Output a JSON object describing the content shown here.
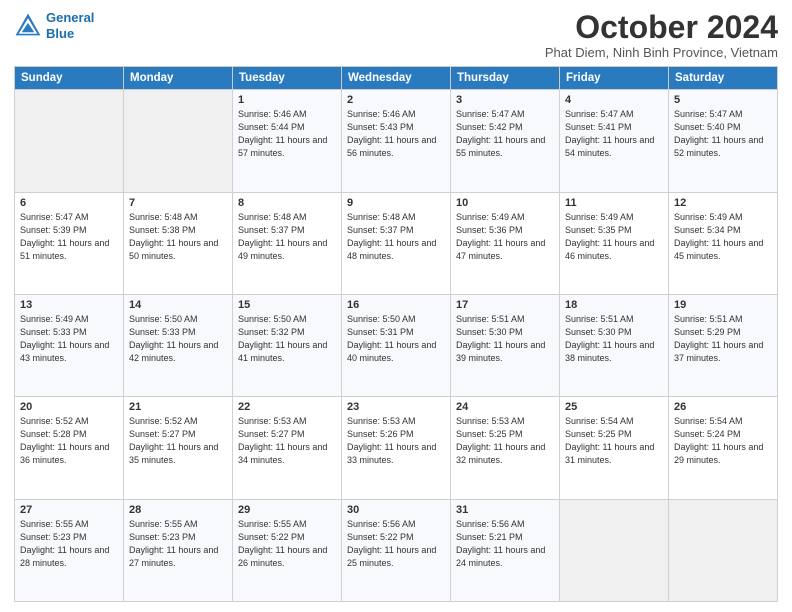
{
  "header": {
    "logo_line1": "General",
    "logo_line2": "Blue",
    "month_year": "October 2024",
    "location": "Phat Diem, Ninh Binh Province, Vietnam"
  },
  "weekdays": [
    "Sunday",
    "Monday",
    "Tuesday",
    "Wednesday",
    "Thursday",
    "Friday",
    "Saturday"
  ],
  "weeks": [
    [
      {
        "day": "",
        "sunrise": "",
        "sunset": "",
        "daylight": ""
      },
      {
        "day": "",
        "sunrise": "",
        "sunset": "",
        "daylight": ""
      },
      {
        "day": "1",
        "sunrise": "Sunrise: 5:46 AM",
        "sunset": "Sunset: 5:44 PM",
        "daylight": "Daylight: 11 hours and 57 minutes."
      },
      {
        "day": "2",
        "sunrise": "Sunrise: 5:46 AM",
        "sunset": "Sunset: 5:43 PM",
        "daylight": "Daylight: 11 hours and 56 minutes."
      },
      {
        "day": "3",
        "sunrise": "Sunrise: 5:47 AM",
        "sunset": "Sunset: 5:42 PM",
        "daylight": "Daylight: 11 hours and 55 minutes."
      },
      {
        "day": "4",
        "sunrise": "Sunrise: 5:47 AM",
        "sunset": "Sunset: 5:41 PM",
        "daylight": "Daylight: 11 hours and 54 minutes."
      },
      {
        "day": "5",
        "sunrise": "Sunrise: 5:47 AM",
        "sunset": "Sunset: 5:40 PM",
        "daylight": "Daylight: 11 hours and 52 minutes."
      }
    ],
    [
      {
        "day": "6",
        "sunrise": "Sunrise: 5:47 AM",
        "sunset": "Sunset: 5:39 PM",
        "daylight": "Daylight: 11 hours and 51 minutes."
      },
      {
        "day": "7",
        "sunrise": "Sunrise: 5:48 AM",
        "sunset": "Sunset: 5:38 PM",
        "daylight": "Daylight: 11 hours and 50 minutes."
      },
      {
        "day": "8",
        "sunrise": "Sunrise: 5:48 AM",
        "sunset": "Sunset: 5:37 PM",
        "daylight": "Daylight: 11 hours and 49 minutes."
      },
      {
        "day": "9",
        "sunrise": "Sunrise: 5:48 AM",
        "sunset": "Sunset: 5:37 PM",
        "daylight": "Daylight: 11 hours and 48 minutes."
      },
      {
        "day": "10",
        "sunrise": "Sunrise: 5:49 AM",
        "sunset": "Sunset: 5:36 PM",
        "daylight": "Daylight: 11 hours and 47 minutes."
      },
      {
        "day": "11",
        "sunrise": "Sunrise: 5:49 AM",
        "sunset": "Sunset: 5:35 PM",
        "daylight": "Daylight: 11 hours and 46 minutes."
      },
      {
        "day": "12",
        "sunrise": "Sunrise: 5:49 AM",
        "sunset": "Sunset: 5:34 PM",
        "daylight": "Daylight: 11 hours and 45 minutes."
      }
    ],
    [
      {
        "day": "13",
        "sunrise": "Sunrise: 5:49 AM",
        "sunset": "Sunset: 5:33 PM",
        "daylight": "Daylight: 11 hours and 43 minutes."
      },
      {
        "day": "14",
        "sunrise": "Sunrise: 5:50 AM",
        "sunset": "Sunset: 5:33 PM",
        "daylight": "Daylight: 11 hours and 42 minutes."
      },
      {
        "day": "15",
        "sunrise": "Sunrise: 5:50 AM",
        "sunset": "Sunset: 5:32 PM",
        "daylight": "Daylight: 11 hours and 41 minutes."
      },
      {
        "day": "16",
        "sunrise": "Sunrise: 5:50 AM",
        "sunset": "Sunset: 5:31 PM",
        "daylight": "Daylight: 11 hours and 40 minutes."
      },
      {
        "day": "17",
        "sunrise": "Sunrise: 5:51 AM",
        "sunset": "Sunset: 5:30 PM",
        "daylight": "Daylight: 11 hours and 39 minutes."
      },
      {
        "day": "18",
        "sunrise": "Sunrise: 5:51 AM",
        "sunset": "Sunset: 5:30 PM",
        "daylight": "Daylight: 11 hours and 38 minutes."
      },
      {
        "day": "19",
        "sunrise": "Sunrise: 5:51 AM",
        "sunset": "Sunset: 5:29 PM",
        "daylight": "Daylight: 11 hours and 37 minutes."
      }
    ],
    [
      {
        "day": "20",
        "sunrise": "Sunrise: 5:52 AM",
        "sunset": "Sunset: 5:28 PM",
        "daylight": "Daylight: 11 hours and 36 minutes."
      },
      {
        "day": "21",
        "sunrise": "Sunrise: 5:52 AM",
        "sunset": "Sunset: 5:27 PM",
        "daylight": "Daylight: 11 hours and 35 minutes."
      },
      {
        "day": "22",
        "sunrise": "Sunrise: 5:53 AM",
        "sunset": "Sunset: 5:27 PM",
        "daylight": "Daylight: 11 hours and 34 minutes."
      },
      {
        "day": "23",
        "sunrise": "Sunrise: 5:53 AM",
        "sunset": "Sunset: 5:26 PM",
        "daylight": "Daylight: 11 hours and 33 minutes."
      },
      {
        "day": "24",
        "sunrise": "Sunrise: 5:53 AM",
        "sunset": "Sunset: 5:25 PM",
        "daylight": "Daylight: 11 hours and 32 minutes."
      },
      {
        "day": "25",
        "sunrise": "Sunrise: 5:54 AM",
        "sunset": "Sunset: 5:25 PM",
        "daylight": "Daylight: 11 hours and 31 minutes."
      },
      {
        "day": "26",
        "sunrise": "Sunrise: 5:54 AM",
        "sunset": "Sunset: 5:24 PM",
        "daylight": "Daylight: 11 hours and 29 minutes."
      }
    ],
    [
      {
        "day": "27",
        "sunrise": "Sunrise: 5:55 AM",
        "sunset": "Sunset: 5:23 PM",
        "daylight": "Daylight: 11 hours and 28 minutes."
      },
      {
        "day": "28",
        "sunrise": "Sunrise: 5:55 AM",
        "sunset": "Sunset: 5:23 PM",
        "daylight": "Daylight: 11 hours and 27 minutes."
      },
      {
        "day": "29",
        "sunrise": "Sunrise: 5:55 AM",
        "sunset": "Sunset: 5:22 PM",
        "daylight": "Daylight: 11 hours and 26 minutes."
      },
      {
        "day": "30",
        "sunrise": "Sunrise: 5:56 AM",
        "sunset": "Sunset: 5:22 PM",
        "daylight": "Daylight: 11 hours and 25 minutes."
      },
      {
        "day": "31",
        "sunrise": "Sunrise: 5:56 AM",
        "sunset": "Sunset: 5:21 PM",
        "daylight": "Daylight: 11 hours and 24 minutes."
      },
      {
        "day": "",
        "sunrise": "",
        "sunset": "",
        "daylight": ""
      },
      {
        "day": "",
        "sunrise": "",
        "sunset": "",
        "daylight": ""
      }
    ]
  ]
}
